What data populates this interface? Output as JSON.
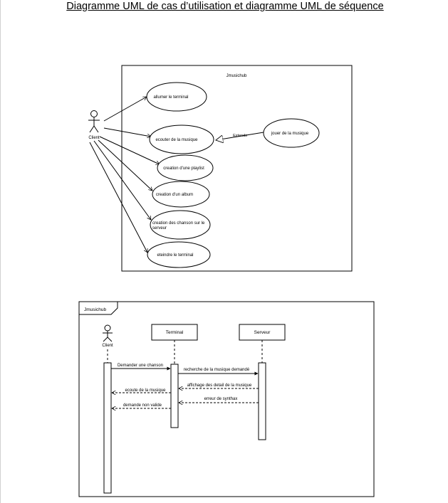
{
  "document": {
    "title": "Diagramme UML de cas d’utilisation et diagramme UML de séquence"
  },
  "use_case_diagram": {
    "system_name": "Jmusichub",
    "actor": "Client",
    "use_cases": [
      "allumer le terminal",
      "ecouter de la musique",
      "creation d'une playlist",
      "creation d'un album",
      "creation des chanson sur le",
      "serveur",
      "eteindre le terminal"
    ],
    "extension_use_case": "jouer de la musique",
    "extend_label": "Extends"
  },
  "sequence_diagram": {
    "frame_label": "Jmusichub",
    "actor": "Client",
    "lifelines": [
      "Terminal",
      "Serveur"
    ],
    "messages": [
      "Demander une chanson",
      "recherche de la musique demandé",
      "affichage des detail de la musique",
      "ecoute de la musique",
      "erreur de synthax",
      "demande non valide"
    ]
  }
}
